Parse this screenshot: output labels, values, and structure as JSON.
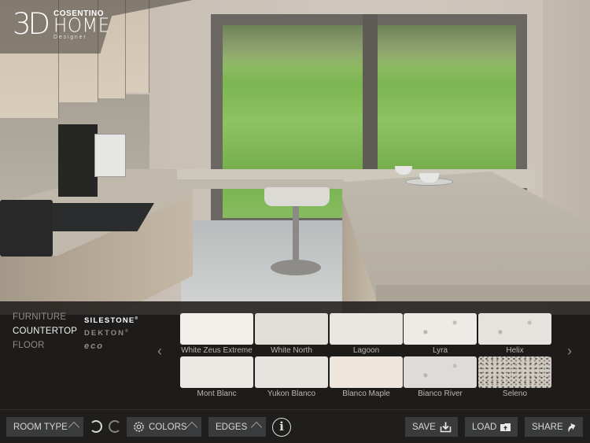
{
  "app": {
    "logo": {
      "mark": "3D",
      "brand": "COSENTINO",
      "product": "HOME",
      "sub": "Designer"
    }
  },
  "panel": {
    "categories": [
      {
        "label": "FURNITURE",
        "active": false
      },
      {
        "label": "COUNTERTOP",
        "active": true
      },
      {
        "label": "FLOOR",
        "active": false
      }
    ],
    "brands": [
      {
        "label": "SILESTONE",
        "mark": "®",
        "active": true
      },
      {
        "label": "DEKTON",
        "mark": "®",
        "active": false
      },
      {
        "label": "eco",
        "mark": "",
        "active": false
      }
    ],
    "prev_icon": "‹",
    "next_icon": "›",
    "swatches": [
      {
        "name": "White Zeus Extreme",
        "color": "#f1efea"
      },
      {
        "name": "White North",
        "color": "#e2dfd9"
      },
      {
        "name": "Lagoon",
        "color": "#e9e7e2"
      },
      {
        "name": "Lyra",
        "color": "#eeebe6"
      },
      {
        "name": "Helix",
        "color": "#e6e3de"
      },
      {
        "name": "Mont Blanc",
        "color": "#ebe9e4"
      },
      {
        "name": "Yukon Blanco",
        "color": "#e7e4df"
      },
      {
        "name": "Blanco Maple",
        "color": "#eee6dc"
      },
      {
        "name": "Bianco River",
        "color": "#dedcd8"
      },
      {
        "name": "Seleno",
        "color": "#cfcac2"
      }
    ]
  },
  "toolbar": {
    "room_type": "ROOM TYPE",
    "colors": "COLORS",
    "edges": "EDGES",
    "info": "i",
    "save": "SAVE",
    "load": "LOAD",
    "share": "SHARE"
  }
}
